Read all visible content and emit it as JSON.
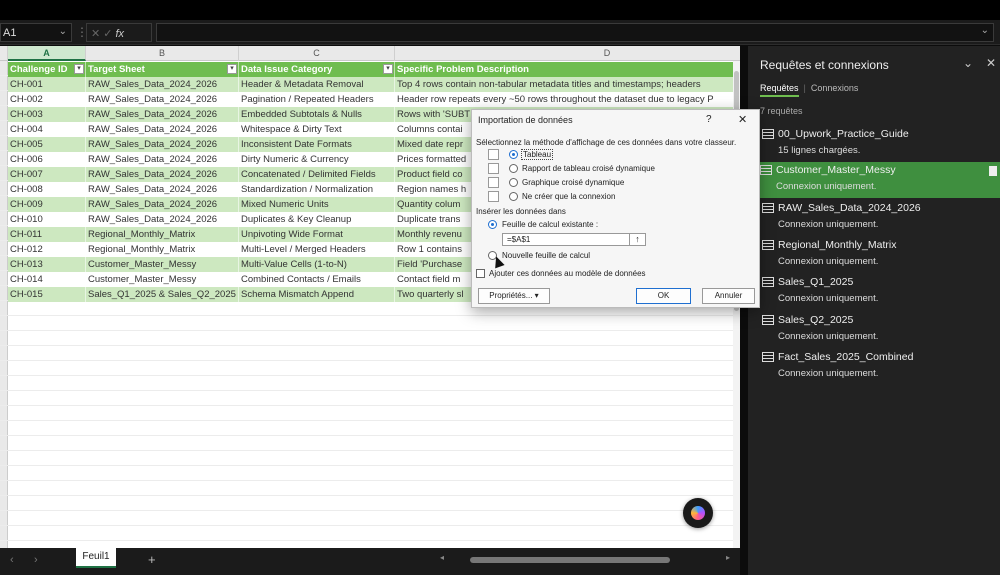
{
  "formula_bar": {
    "name_box": "A1",
    "fx": "fx"
  },
  "columns": [
    {
      "letter": "A",
      "selected": true
    },
    {
      "letter": "B",
      "selected": false
    },
    {
      "letter": "C",
      "selected": false
    },
    {
      "letter": "D",
      "selected": false
    }
  ],
  "table": {
    "headers": [
      "Challenge ID",
      "Target Sheet",
      "Data Issue Category",
      "Specific Problem Description"
    ],
    "rows": [
      [
        "CH-001",
        "RAW_Sales_Data_2024_2026",
        "Header & Metadata Removal",
        "Top 4 rows contain non-tabular metadata titles and timestamps; headers"
      ],
      [
        "CH-002",
        "RAW_Sales_Data_2024_2026",
        "Pagination / Repeated Headers",
        "Header row repeats every ~50 rows throughout the dataset due to legacy P"
      ],
      [
        "CH-003",
        "RAW_Sales_Data_2024_2026",
        "Embedded Subtotals & Nulls",
        "Rows with 'SUBT"
      ],
      [
        "CH-004",
        "RAW_Sales_Data_2024_2026",
        "Whitespace & Dirty Text",
        "Columns contai"
      ],
      [
        "CH-005",
        "RAW_Sales_Data_2024_2026",
        "Inconsistent Date Formats",
        "Mixed date repr"
      ],
      [
        "CH-006",
        "RAW_Sales_Data_2024_2026",
        "Dirty Numeric & Currency",
        "Prices formatted"
      ],
      [
        "CH-007",
        "RAW_Sales_Data_2024_2026",
        "Concatenated / Delimited Fields",
        "Product field co"
      ],
      [
        "CH-008",
        "RAW_Sales_Data_2024_2026",
        "Standardization / Normalization",
        "Region names h"
      ],
      [
        "CH-009",
        "RAW_Sales_Data_2024_2026",
        "Mixed Numeric Units",
        "Quantity colum"
      ],
      [
        "CH-010",
        "RAW_Sales_Data_2024_2026",
        "Duplicates & Key Cleanup",
        "Duplicate trans"
      ],
      [
        "CH-011",
        "Regional_Monthly_Matrix",
        "Unpivoting Wide Format",
        "Monthly revenu"
      ],
      [
        "CH-012",
        "Regional_Monthly_Matrix",
        "Multi-Level / Merged Headers",
        "Row 1 contains"
      ],
      [
        "CH-013",
        "Customer_Master_Messy",
        "Multi-Value Cells (1-to-N)",
        "Field 'Purchase"
      ],
      [
        "CH-014",
        "Customer_Master_Messy",
        "Combined Contacts / Emails",
        "Contact field m"
      ],
      [
        "CH-015",
        "Sales_Q1_2025 & Sales_Q2_2025",
        "Schema Mismatch Append",
        "Two quarterly sl"
      ]
    ]
  },
  "sheet_tab": {
    "name": "Feuil1"
  },
  "queries_pane": {
    "title": "Requêtes et connexions",
    "tab_queries": "Requêtes",
    "tab_connections": "Connexions",
    "count": "7 requêtes",
    "items": [
      {
        "name": "00_Upwork_Practice_Guide",
        "status": "15 lignes chargées."
      },
      {
        "name": "Customer_Master_Messy",
        "status": "Connexion uniquement."
      },
      {
        "name": "RAW_Sales_Data_2024_2026",
        "status": "Connexion uniquement."
      },
      {
        "name": "Regional_Monthly_Matrix",
        "status": "Connexion uniquement."
      },
      {
        "name": "Sales_Q1_2025",
        "status": "Connexion uniquement."
      },
      {
        "name": "Sales_Q2_2025",
        "status": "Connexion uniquement."
      },
      {
        "name": "Fact_Sales_2025_Combined",
        "status": "Connexion uniquement."
      }
    ]
  },
  "dialog": {
    "title": "Importation de données",
    "help": "?",
    "close": "✕",
    "prompt": "Sélectionnez la méthode d'affichage de ces données dans votre classeur.",
    "view_options": [
      "Tableau",
      "Rapport de tableau croisé dynamique",
      "Graphique croisé dynamique",
      "Ne créer que la connexion"
    ],
    "placement_label": "Insérer les données dans",
    "existing_sheet": "Feuille de calcul existante :",
    "cell_ref": "=$A$1",
    "ref_button": "↑",
    "new_sheet": "Nouvelle feuille de calcul",
    "data_model": "Ajouter ces données au modèle de données",
    "properties": "Propriétés...",
    "ok": "OK",
    "cancel": "Annuler"
  }
}
